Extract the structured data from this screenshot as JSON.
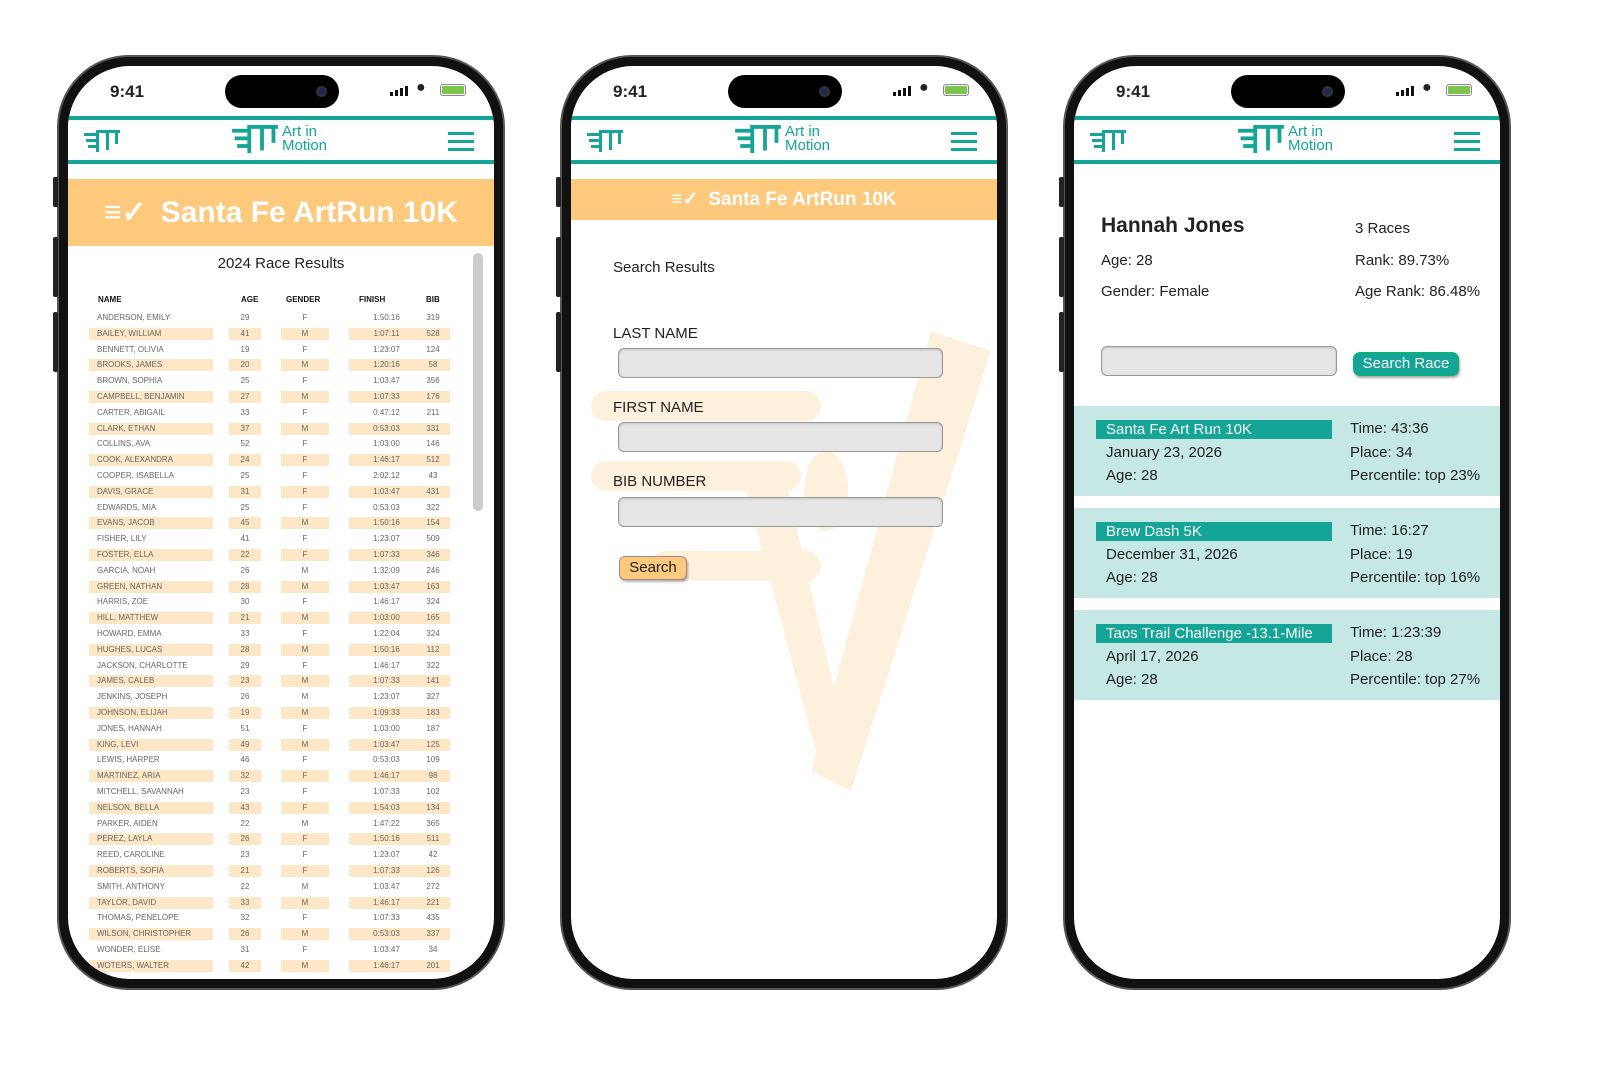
{
  "status": {
    "time": "9:41"
  },
  "brand": {
    "name_line1": "Art in",
    "name_line2": "Motion",
    "color": "#14a596",
    "accent": "#fcc97d"
  },
  "phone1": {
    "banner_title": "Santa Fe ArtRun 10K",
    "subtitle": "2024 Race Results",
    "columns": [
      "NAME",
      "AGE",
      "GENDER",
      "FINISH",
      "BIB"
    ],
    "rows": [
      [
        "ANDERSON, EMILY",
        "29",
        "F",
        "1:50:16",
        "319"
      ],
      [
        "BAILEY, WILLIAM",
        "41",
        "M",
        "1:07:11",
        "528"
      ],
      [
        "BENNETT, OLIVIA",
        "19",
        "F",
        "1:23:07",
        "124"
      ],
      [
        "BROOKS, JAMES",
        "20",
        "M",
        "1:20:16",
        "58"
      ],
      [
        "BROWN, SOPHIA",
        "25",
        "F",
        "1:03:47",
        "356"
      ],
      [
        "CAMPBELL, BENJAMIN",
        "27",
        "M",
        "1:07:33",
        "176"
      ],
      [
        "CARTER, ABIGAIL",
        "33",
        "F",
        "0:47:12",
        "211"
      ],
      [
        "CLARK, ETHAN",
        "37",
        "M",
        "0:53:03",
        "331"
      ],
      [
        "COLLINS, AVA",
        "52",
        "F",
        "1:03:00",
        "146"
      ],
      [
        "COOK, ALEXANDRA",
        "24",
        "F",
        "1:46:17",
        "512"
      ],
      [
        "COOPER, ISABELLA",
        "25",
        "F",
        "2:02:12",
        "43"
      ],
      [
        "DAVIS, GRACE",
        "31",
        "F",
        "1:03:47",
        "431"
      ],
      [
        "EDWARDS, MIA",
        "25",
        "F",
        "0:53:03",
        "322"
      ],
      [
        "EVANS, JACOB",
        "45",
        "M",
        "1:50:16",
        "154"
      ],
      [
        "FISHER, LILY",
        "41",
        "F",
        "1:23:07",
        "509"
      ],
      [
        "FOSTER, ELLA",
        "22",
        "F",
        "1:07:33",
        "346"
      ],
      [
        "GARCIA, NOAH",
        "26",
        "M",
        "1:32:09",
        "246"
      ],
      [
        "GREEN, NATHAN",
        "28",
        "M",
        "1:03:47",
        "163"
      ],
      [
        "HARRIS, ZOE",
        "30",
        "F",
        "1:46:17",
        "324"
      ],
      [
        "HILL, MATTHEW",
        "21",
        "M",
        "1:03:00",
        "165"
      ],
      [
        "HOWARD, EMMA",
        "33",
        "F",
        "1:22:04",
        "324"
      ],
      [
        "HUGHES, LUCAS",
        "28",
        "M",
        "1:50:16",
        "112"
      ],
      [
        "JACKSON, CHARLOTTE",
        "29",
        "F",
        "1:46:17",
        "322"
      ],
      [
        "JAMES, CALEB",
        "23",
        "M",
        "1:07:33",
        "141"
      ],
      [
        "JENKINS, JOSEPH",
        "26",
        "M",
        "1:23:07",
        "327"
      ],
      [
        "JOHNSON, ELIJAH",
        "19",
        "M",
        "1:09:33",
        "183"
      ],
      [
        "JONES, HANNAH",
        "51",
        "F",
        "1:03:00",
        "187"
      ],
      [
        "KING, LEVI",
        "49",
        "M",
        "1:03:47",
        "125"
      ],
      [
        "LEWIS, HARPER",
        "46",
        "F",
        "0:53:03",
        "109"
      ],
      [
        "MARTINEZ, ARIA",
        "32",
        "F",
        "1:46:17",
        "98"
      ],
      [
        "MITCHELL, SAVANNAH",
        "23",
        "F",
        "1:07:33",
        "102"
      ],
      [
        "NELSON, BELLA",
        "43",
        "F",
        "1:54:03",
        "134"
      ],
      [
        "PARKER, AIDEN",
        "22",
        "M",
        "1:47:22",
        "365"
      ],
      [
        "PEREZ, LAYLA",
        "26",
        "F",
        "1:50:16",
        "511"
      ],
      [
        "REED, CAROLINE",
        "23",
        "F",
        "1:23:07",
        "42"
      ],
      [
        "ROBERTS, SOFIA",
        "21",
        "F",
        "1:07:33",
        "126"
      ],
      [
        "SMITH, ANTHONY",
        "22",
        "M",
        "1:03:47",
        "272"
      ],
      [
        "TAYLOR, DAVID",
        "33",
        "M",
        "1:46:17",
        "221"
      ],
      [
        "THOMAS, PENELOPE",
        "32",
        "F",
        "1:07:33",
        "435"
      ],
      [
        "WILSON, CHRISTOPHER",
        "26",
        "M",
        "0:53:03",
        "337"
      ],
      [
        "WONDER, ELISE",
        "31",
        "F",
        "1:03:47",
        "34"
      ],
      [
        "WOTERS, WALTER",
        "42",
        "M",
        "1:46:17",
        "201"
      ]
    ]
  },
  "phone2": {
    "banner_title": "Santa Fe ArtRun 10K",
    "heading": "Search Results",
    "last_name_label": "LAST NAME",
    "last_name_value": "",
    "first_name_label": "FIRST NAME",
    "first_name_value": "",
    "bib_label": "BIB NUMBER",
    "bib_value": "",
    "search_label": "Search"
  },
  "phone3": {
    "name": "Hannah Jones",
    "races_count": "3 Races",
    "age": "Age: 28",
    "rank": "Rank: 89.73%",
    "gender": "Gender: Female",
    "age_rank": "Age Rank: 86.48%",
    "search_value": "",
    "search_label": "Search Race",
    "races": [
      {
        "title": "Santa Fe Art Run 10K",
        "date": "January 23, 2026",
        "age": "Age: 28",
        "time": "Time: 43:36",
        "place": "Place: 34",
        "percentile": "Percentile: top 23%"
      },
      {
        "title": "Brew Dash 5K",
        "date": "December 31, 2026",
        "age": "Age: 28",
        "time": "Time: 16:27",
        "place": "Place: 19",
        "percentile": "Percentile: top 16%"
      },
      {
        "title": "Taos Trail Challenge -13.1-Mile",
        "date": "April 17, 2026",
        "age": "Age: 28",
        "time": "Time: 1:23:39",
        "place": "Place: 28",
        "percentile": "Percentile: top 27%"
      }
    ]
  }
}
